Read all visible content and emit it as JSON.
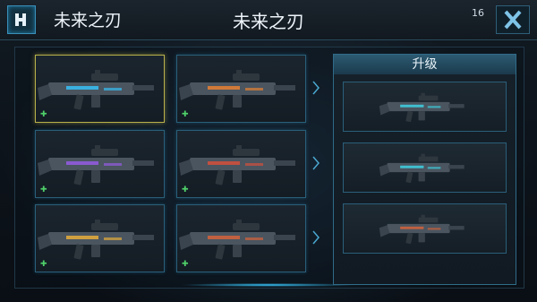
{
  "header": {
    "title": "未来之刃",
    "center_title": "未来之刃",
    "counter": "16"
  },
  "icons": {
    "back": "back-icon",
    "close": "close-icon",
    "upgrade_marker": "plus-icon"
  },
  "colors": {
    "accent": "#3a8fb8",
    "selected_border": "#b8b04a",
    "marker": "#4fd06a"
  },
  "weapon_slots": [
    {
      "state": "selected",
      "accent": "#3ab0e0"
    },
    {
      "state": "normal",
      "accent": "#d07a3a"
    },
    {
      "state": "normal",
      "accent": "#8a5ad0"
    },
    {
      "state": "normal",
      "accent": "#c05040"
    },
    {
      "state": "normal",
      "accent": "#d0a040"
    },
    {
      "state": "normal",
      "accent": "#c06040"
    }
  ],
  "upgrade": {
    "title": "升级",
    "items": [
      {
        "accent": "#40c0d0"
      },
      {
        "accent": "#40c0d0"
      },
      {
        "accent": "#c06040"
      }
    ]
  }
}
